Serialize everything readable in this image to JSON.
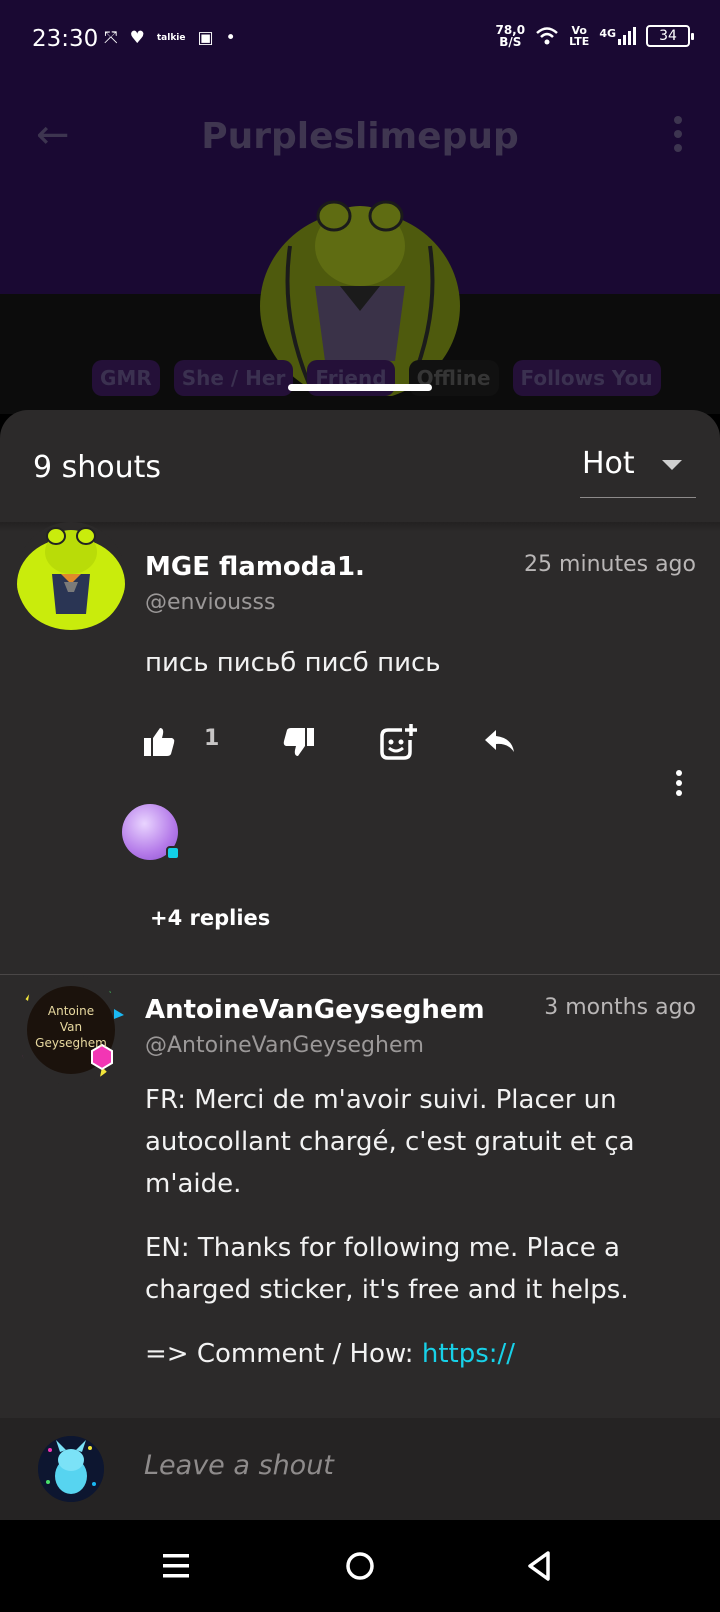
{
  "status": {
    "time": "23:30",
    "talkie": "talkie",
    "speed_top": "78,0",
    "speed_bottom": "B/S",
    "volte_top": "Vo",
    "volte_bottom": "LTE",
    "network": "4G",
    "battery": "34"
  },
  "header": {
    "title": "Purpleslimepup",
    "tags": [
      "GMR",
      "She / Her",
      "Friend",
      "Offline",
      "Follows You"
    ]
  },
  "sheet": {
    "count": "9 shouts",
    "sort": "Hot"
  },
  "shouts": [
    {
      "name": "MGE flamoda1.",
      "handle": "@enviousss",
      "time": "25 minutes ago",
      "text": "пись письб писб пись",
      "likes": "1",
      "replies": "+4 replies"
    },
    {
      "name": "AntoineVanGeyseghem",
      "handle": "@AntoineVanGeyseghem",
      "time": "3 months ago",
      "avatar_text": [
        "Antoine",
        "Van",
        "Geyseghem"
      ],
      "paragraphs": [
        "FR: Merci de m'avoir suivi. Placer un autocollant chargé, c'est gratuit et ça m'aide.",
        "EN: Thanks for following me. Place a charged sticker, it's free and it helps."
      ],
      "comment_prefix": "=> Comment / How: ",
      "comment_link": "https://"
    }
  ],
  "composer": {
    "placeholder": "Leave a shout"
  },
  "colors": {
    "accent_link": "#18d1e8",
    "sheet_bg": "#2c2a2a",
    "header_bg": "#1a0933"
  }
}
